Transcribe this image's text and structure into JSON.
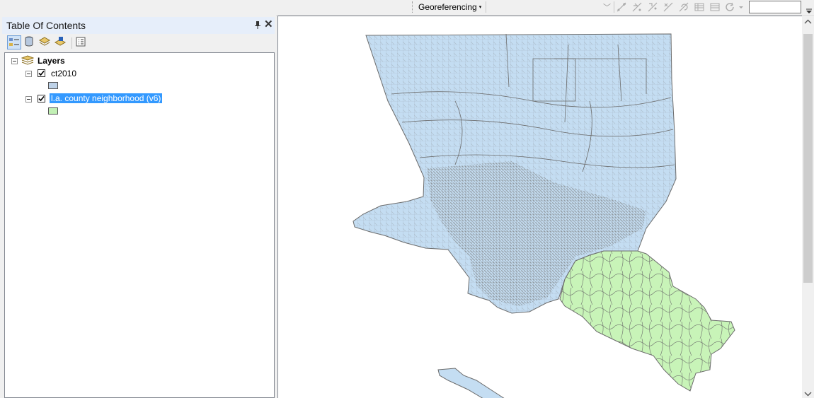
{
  "toolbar": {
    "georeferencing_label": "Georeferencing",
    "dropdown_arrow": "▾",
    "scale_value": ""
  },
  "toc": {
    "title": "Table Of Contents",
    "pin_glyph": "📌",
    "close_glyph": "✕",
    "root_layer": "Layers",
    "layers": [
      {
        "name": "ct2010",
        "checked": true,
        "selected": false,
        "swatch_color": "#bed2e8"
      },
      {
        "name": "l.a. county neighborhood (v6)",
        "checked": true,
        "selected": true,
        "swatch_color": "#c2f0b5"
      }
    ]
  },
  "map": {
    "la_county_fill": "#c4ddf2",
    "orange_county_fill": "#c8f4b8",
    "outline_color": "#6b6b6b"
  },
  "colors": {
    "selection": "#3399ff",
    "titlebar": "#e6eefa"
  }
}
